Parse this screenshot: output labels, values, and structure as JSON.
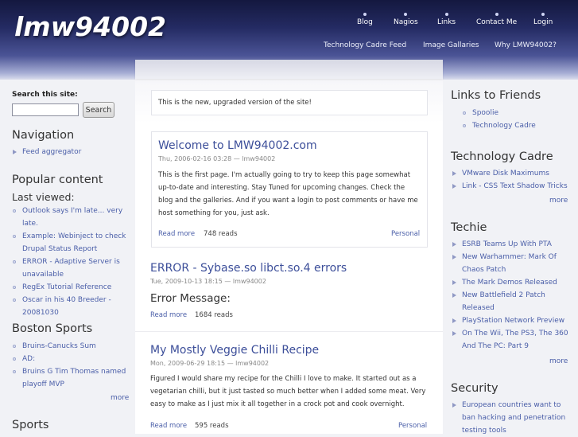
{
  "header": {
    "logo": "lmw94002",
    "nav_primary": [
      "Blog",
      "Nagios",
      "Links",
      "Contact Me",
      "Login"
    ],
    "nav_secondary": [
      "Technology Cadre Feed",
      "Image Gallaries",
      "Why LMW94002?"
    ]
  },
  "search": {
    "label": "Search this site:",
    "value": "",
    "button": "Search"
  },
  "left": {
    "navigation": {
      "title": "Navigation",
      "items": [
        "Feed aggregator"
      ]
    },
    "popular": {
      "title": "Popular content",
      "subtitle": "Last viewed:",
      "items": [
        "Outlook says I'm late... very late.",
        "Example: Webinject to check Drupal Status Report",
        "ERROR - Adaptive Server is unavailable",
        "RegEx Tutorial Reference",
        "Oscar in his 40 Breeder - 20081030"
      ]
    },
    "boston": {
      "title": "Boston Sports",
      "items": [
        "Bruins-Canucks Sum",
        "AD:",
        "Bruins G Tim Thomas named playoff MVP"
      ],
      "more": "more"
    },
    "sports": {
      "title": "Sports"
    }
  },
  "main": {
    "notice": "This is the new, upgraded version of the site!",
    "posts": [
      {
        "title": "Welcome to LMW94002.com",
        "meta": "Thu, 2006-02-16 03:28 — lmw94002",
        "body": "This is the first page. I'm actually going to try to keep this page somewhat up-to-date and interesting. Stay Tuned for upcoming changes. Check the blog and the galleries. And if you want a login to post comments or have me host something for you, just ask.",
        "read_more": "Read more",
        "reads": "748 reads",
        "category": "Personal"
      },
      {
        "title": "ERROR - Sybase.so libct.so.4 errors",
        "meta": "Tue, 2009-10-13 18:15 — lmw94002",
        "heading": "Error Message:",
        "read_more": "Read more",
        "reads": "1684 reads"
      },
      {
        "title": "My Mostly Veggie Chilli Recipe",
        "meta": "Mon, 2009-06-29 18:15 — lmw94002",
        "body": "Figured I would share my recipe for the Chilli I love to make.  It started out as a vegetarian chilli, but it just tasted so much better when I added some meat.  Very easy to make as I just mix it all together in a crock pot and cook overnight.",
        "read_more": "Read more",
        "reads": "595 reads",
        "category": "Personal"
      }
    ]
  },
  "right": {
    "friends": {
      "title": "Links to Friends",
      "items": [
        "Spoolie",
        "Technology Cadre"
      ]
    },
    "techcadre": {
      "title": "Technology Cadre",
      "items": [
        "VMware Disk Maximums",
        "Link - CSS Text Shadow Tricks"
      ],
      "more": "more"
    },
    "techie": {
      "title": "Techie",
      "items": [
        "ESRB Teams Up With PTA",
        "New Warhammer: Mark Of Chaos Patch",
        "The Mark Demos Released",
        "New Battlefield 2 Patch Released",
        "PlayStation Network Preview",
        "On The Wii, The PS3, The 360 And The PC: Part 9"
      ],
      "more": "more"
    },
    "security": {
      "title": "Security",
      "items": [
        "European countries want to ban hacking and penetration testing tools"
      ]
    }
  }
}
